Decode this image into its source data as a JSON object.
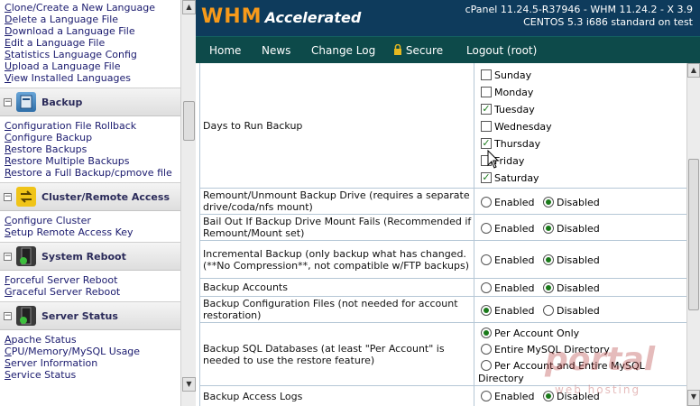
{
  "sidebar": {
    "top_links": [
      {
        "first": "C",
        "rest": "lone/Create a New Language"
      },
      {
        "first": "D",
        "rest": "elete a Language File"
      },
      {
        "first": "D",
        "rest": "ownload a Language File"
      },
      {
        "first": "E",
        "rest": "dit a Language File"
      },
      {
        "first": "S",
        "rest": "tatistics Language Config"
      },
      {
        "first": "U",
        "rest": "pload a Language File"
      },
      {
        "first": "V",
        "rest": "iew Installed Languages"
      }
    ],
    "backup": {
      "label": "Backup",
      "links": [
        {
          "first": "C",
          "rest": "onfiguration File Rollback"
        },
        {
          "first": "C",
          "rest": "onfigure Backup"
        },
        {
          "first": "R",
          "rest": "estore Backups"
        },
        {
          "first": "R",
          "rest": "estore Multiple Backups"
        },
        {
          "first": "R",
          "rest": "estore a Full Backup/cpmove file"
        }
      ]
    },
    "cluster": {
      "label": "Cluster/Remote Access",
      "links": [
        {
          "first": "C",
          "rest": "onfigure Cluster"
        },
        {
          "first": "S",
          "rest": "etup Remote Access Key"
        }
      ]
    },
    "reboot": {
      "label": "System Reboot",
      "links": [
        {
          "first": "F",
          "rest": "orceful Server Reboot"
        },
        {
          "first": "G",
          "rest": "raceful Server Reboot"
        }
      ]
    },
    "status": {
      "label": "Server Status",
      "links": [
        {
          "first": "A",
          "rest": "pache Status"
        },
        {
          "first": "C",
          "rest": "PU/Memory/MySQL Usage"
        },
        {
          "first": "S",
          "rest": "erver Information"
        },
        {
          "first": "S",
          "rest": "ervice Status"
        }
      ]
    }
  },
  "header": {
    "logo_main": "WHM",
    "logo_sub": "Accelerated",
    "version_line1": "cPanel 11.24.5-R37946 - WHM 11.24.2 - X 3.9",
    "version_line2": "CENTOS 5.3 i686 standard on test"
  },
  "nav": {
    "home": "Home",
    "news": "News",
    "changelog": "Change Log",
    "secure": "Secure",
    "logout": "Logout (root)"
  },
  "form": {
    "days_label": "Days to Run Backup",
    "days": [
      {
        "name": "Sunday",
        "checked": false
      },
      {
        "name": "Monday",
        "checked": false
      },
      {
        "name": "Tuesday",
        "checked": true
      },
      {
        "name": "Wednesday",
        "checked": false
      },
      {
        "name": "Thursday",
        "checked": true
      },
      {
        "name": "Friday",
        "checked": false
      },
      {
        "name": "Saturday",
        "checked": true
      }
    ],
    "remount_label": "Remount/Unmount Backup Drive (requires a separate drive/coda/nfs mount)",
    "bailout_label": "Bail Out If Backup Drive Mount Fails (Recommended if Remount/Mount set)",
    "incremental_label": "Incremental Backup (only backup what has changed. (**No Compression**, not compatible w/FTP backups)",
    "accounts_label": "Backup Accounts",
    "config_label": "Backup Configuration Files (not needed for account restoration)",
    "sql_label": "Backup SQL Databases (at least \"Per Account\" is needed to use the restore feature)",
    "access_logs_label": "Backup Access Logs",
    "enabled": "Enabled",
    "disabled": "Disabled",
    "sql_opt1": "Per Account Only",
    "sql_opt2": "Entire MySQL Directory",
    "sql_opt3a": "Per Account and Entire MySQL",
    "sql_opt3b": "Directory"
  },
  "watermark": {
    "main": "portal",
    "sub": "web hosting"
  },
  "colors": {
    "header_bg": "#0e3b5c",
    "nav_bg": "#0d4a4a",
    "logo_orange": "#f79a1a"
  }
}
